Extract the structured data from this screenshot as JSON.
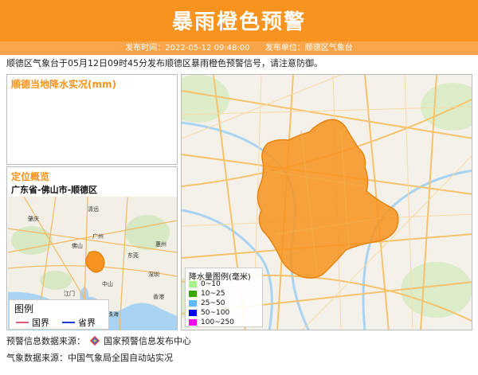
{
  "header": {
    "title": "暴雨橙色预警",
    "issue_time_label": "发布时间：2022-05-12 09:48:00",
    "issuer_label": "发布单位：顺德区气象台"
  },
  "notice": "顺德区气象台于05月12日09时45分发布顺德区暴雨橙色预警信号，请注意防御。",
  "rain_panel": {
    "title": "顺德当地降水实况(mm)"
  },
  "location_panel": {
    "title": "定位概览",
    "path": "广东省-佛山市-顺德区",
    "map_labels": [
      "佛山",
      "广州",
      "江门",
      "中山",
      "珠海",
      "深圳",
      "香港",
      "肇庆",
      "清远",
      "惠州",
      "东莞"
    ],
    "legend": {
      "title": "图例",
      "items": [
        {
          "label": "国界",
          "color": "#e05a7a"
        },
        {
          "label": "省界",
          "color": "#1a3fcf"
        }
      ]
    }
  },
  "main_map": {
    "warning_color": "#f7931e",
    "legend": {
      "title": "降水量图例(毫米)",
      "items": [
        {
          "label": "0~10",
          "color": "#a5f28a"
        },
        {
          "label": "10~25",
          "color": "#38a800"
        },
        {
          "label": "25~50",
          "color": "#61b8ff"
        },
        {
          "label": "50~100",
          "color": "#0000ff"
        },
        {
          "label": "100~250",
          "color": "#fa00fa"
        }
      ]
    }
  },
  "footer": {
    "warning_source": "预警信息数据来源：",
    "warning_source_org": "国家预警信息发布中心",
    "weather_source": "气象数据来源：中国气象局全国自动站实况"
  }
}
